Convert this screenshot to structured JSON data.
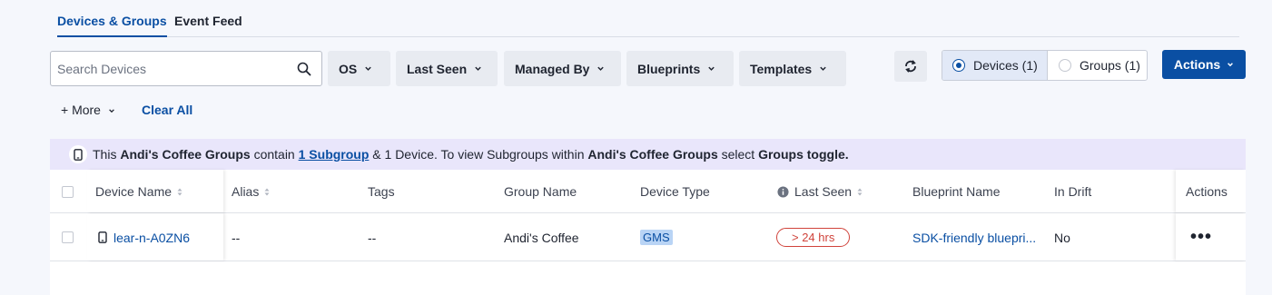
{
  "tabs": [
    {
      "label": "Devices & Groups",
      "active": true
    },
    {
      "label": "Event Feed",
      "active": false
    }
  ],
  "search": {
    "placeholder": "Search Devices",
    "value": ""
  },
  "filters": [
    "OS",
    "Last Seen",
    "Managed By",
    "Blueprints",
    "Templates"
  ],
  "view_toggle": {
    "devices_label": "Devices (1)",
    "groups_label": "Groups (1)",
    "selected": "devices"
  },
  "actions_button": "Actions",
  "more_filters": "+ More",
  "clear_all": "Clear All",
  "banner": {
    "prefix": "This",
    "group_name": "Andi's Coffee Groups",
    "contain": "contain",
    "subgroup_link": "1 Subgroup",
    "middle": "& 1 Device. To view Subgroups within",
    "group_name2": "Andi's Coffee Groups",
    "select": "select",
    "toggle_name": "Groups toggle."
  },
  "table": {
    "headers": [
      "Device Name",
      "Alias",
      "Tags",
      "Group Name",
      "Device Type",
      "Last Seen",
      "Blueprint Name",
      "In Drift",
      "Actions"
    ],
    "rows": [
      {
        "device_name": "lear-n-A0ZN6",
        "alias": "--",
        "tags": "--",
        "group_name": "Andi's Coffee",
        "device_type": "GMS",
        "last_seen": "> 24 hrs",
        "blueprint_name": "SDK-friendly bluepri...",
        "in_drift": "No",
        "actions": "•••"
      }
    ]
  },
  "colors": {
    "accent": "#0a4fa3",
    "banner_bg": "#e9e6fb",
    "warning": "#d0433b",
    "page_bg": "#f5f7fc"
  }
}
